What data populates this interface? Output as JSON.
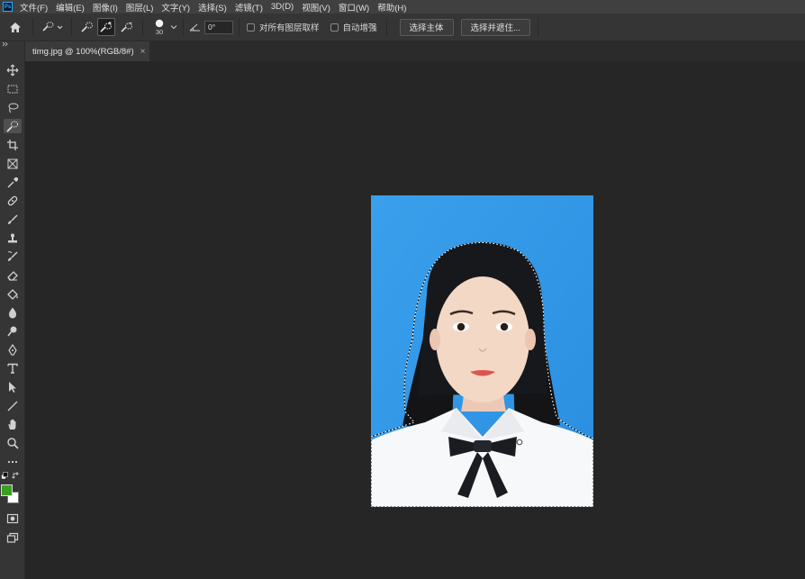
{
  "menubar": {
    "app_logo": "Ps",
    "items": [
      "文件(F)",
      "编辑(E)",
      "图像(I)",
      "图层(L)",
      "文字(Y)",
      "选择(S)",
      "滤镜(T)",
      "3D(D)",
      "视图(V)",
      "窗口(W)",
      "帮助(H)"
    ]
  },
  "options": {
    "brush_size": "30",
    "angle": "0°",
    "sample_all_layers": "对所有图层取样",
    "auto_enhance": "自动增强",
    "select_subject": "选择主体",
    "select_and_mask": "选择并遮住..."
  },
  "document": {
    "tab_title": "timg.jpg @ 100%(RGB/8#)",
    "close": "×"
  },
  "colors": {
    "foreground": "#3aa020",
    "background": "#ffffff",
    "photo_background": "#3b9ae6"
  },
  "tools": [
    "move-icon",
    "marquee-icon",
    "lasso-icon",
    "quick-selection-icon",
    "crop-icon",
    "frame-icon",
    "eyedropper-icon",
    "healing-brush-icon",
    "brush-icon",
    "clone-stamp-icon",
    "history-brush-icon",
    "eraser-icon",
    "paint-bucket-icon",
    "blur-icon",
    "dodge-icon",
    "pen-icon",
    "type-icon",
    "path-selection-icon",
    "line-icon",
    "hand-icon",
    "zoom-icon",
    "more-tools-icon"
  ]
}
